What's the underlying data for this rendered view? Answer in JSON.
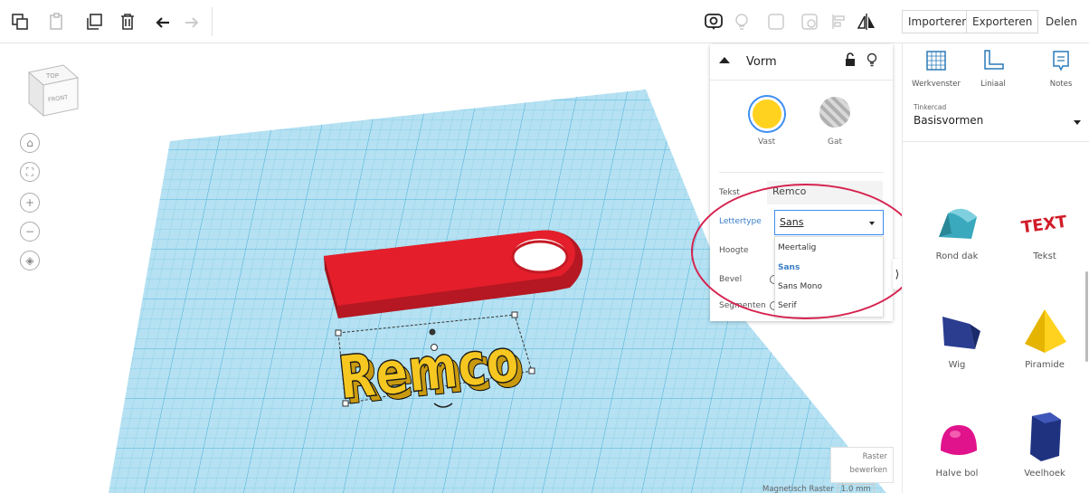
{
  "toolbar": {
    "import_label": "Importeren",
    "export_label": "Exporteren",
    "share_label": "Delen"
  },
  "viewcube": {
    "top_label": "TOP",
    "front_label": "FRONT"
  },
  "inspector": {
    "title": "Vorm",
    "solid_label": "Vast",
    "hole_label": "Gat",
    "text_label": "Tekst",
    "text_value": "Remco",
    "font_label": "Lettertype",
    "font_value": "Sans",
    "height_label": "Hoogte",
    "bevel_label": "Bevel",
    "segments_label": "Segmenten",
    "font_options": [
      "Meertalig",
      "Sans",
      "Sans Mono",
      "Serif"
    ]
  },
  "scene": {
    "text_object": "Remco",
    "grid_color": "#a8dcef",
    "grid_line_color": "#6fc0e0",
    "keychain_color": "#e41f2b",
    "text_color": "#f6c720"
  },
  "sidebar": {
    "workplane_label": "Werkvenster",
    "ruler_label": "Liniaal",
    "notes_label": "Notes",
    "library_small": "Tinkercad",
    "library_name": "Basisvormen",
    "shapes": [
      {
        "label": "Rond dak"
      },
      {
        "label": "Tekst"
      },
      {
        "label": "Wig"
      },
      {
        "label": "Piramide"
      },
      {
        "label": "Halve bol"
      },
      {
        "label": "Veelhoek"
      }
    ],
    "text_thumb": "TEXT"
  },
  "footer": {
    "edit_grid_line1": "Raster",
    "edit_grid_line2": "bewerken",
    "snap_label": "Magnetisch Raster",
    "snap_value": "1.0 mm"
  }
}
